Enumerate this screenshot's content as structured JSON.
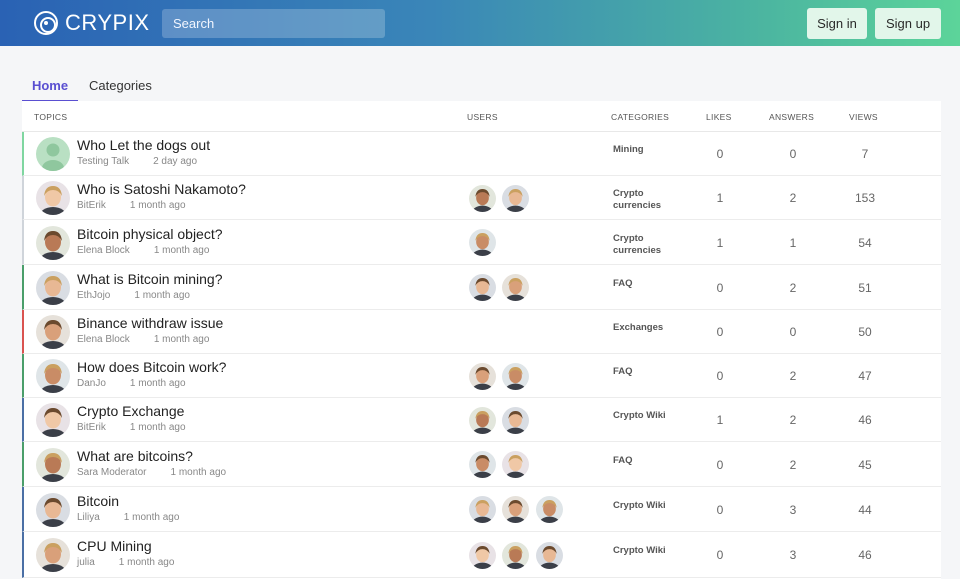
{
  "header": {
    "logo_text": "CRYPIX",
    "search_placeholder": "Search",
    "signin_label": "Sign in",
    "signup_label": "Sign up",
    "colors": {
      "gradient_start": "#2a62b4",
      "gradient_end": "#5cd49a",
      "button_bg": "#e2f6ea"
    }
  },
  "tabs": [
    {
      "label": "Home",
      "active": true
    },
    {
      "label": "Categories",
      "active": false
    }
  ],
  "accent_color": "#5a4fd1",
  "columns": {
    "topics": "TOPICS",
    "users": "USERS",
    "categories": "CATEGORIES",
    "likes": "LIKES",
    "answers": "ANSWERS",
    "views": "VIEWS"
  },
  "topics": [
    {
      "title": "Who Let the dogs out",
      "author": "Testing Talk",
      "time": "2 day ago",
      "category": "Mining",
      "likes": "0",
      "answers": "0",
      "views": "7",
      "border_color": "#7fd6a0",
      "avatar_icon": "default-avatar-icon",
      "users": []
    },
    {
      "title": "Who is Satoshi Nakamoto?",
      "author": "BitErik",
      "time": "1 month ago",
      "category": "Crypto currencies",
      "likes": "1",
      "answers": "2",
      "views": "153",
      "border_color": "#cfd4da",
      "avatar_icon": "user-avatar-icon",
      "users": [
        "user-avatar-icon",
        "user-avatar-icon"
      ]
    },
    {
      "title": "Bitcoin physical object?",
      "author": "Elena Block",
      "time": "1 month ago",
      "category": "Crypto currencies",
      "likes": "1",
      "answers": "1",
      "views": "54",
      "border_color": "#cfd4da",
      "avatar_icon": "user-avatar-icon",
      "users": [
        "user-avatar-icon"
      ]
    },
    {
      "title": "What is Bitcoin mining?",
      "author": "EthJojo",
      "time": "1 month ago",
      "category": "FAQ",
      "likes": "0",
      "answers": "2",
      "views": "51",
      "border_color": "#4a9e6a",
      "avatar_icon": "user-avatar-icon",
      "users": [
        "user-avatar-icon",
        "user-avatar-icon"
      ]
    },
    {
      "title": "Binance withdraw issue",
      "author": "Elena Block",
      "time": "1 month ago",
      "category": "Exchanges",
      "likes": "0",
      "answers": "0",
      "views": "50",
      "border_color": "#d9534f",
      "avatar_icon": "user-avatar-icon",
      "users": []
    },
    {
      "title": "How does Bitcoin work?",
      "author": "DanJo",
      "time": "1 month ago",
      "category": "FAQ",
      "likes": "0",
      "answers": "2",
      "views": "47",
      "border_color": "#4a9e6a",
      "avatar_icon": "user-avatar-icon",
      "users": [
        "user-avatar-icon",
        "user-avatar-icon"
      ]
    },
    {
      "title": "Crypto Exchange",
      "author": "BitErik",
      "time": "1 month ago",
      "category": "Crypto Wiki",
      "likes": "1",
      "answers": "2",
      "views": "46",
      "border_color": "#4a6fa5",
      "avatar_icon": "user-avatar-icon",
      "users": [
        "user-avatar-icon",
        "user-avatar-icon"
      ]
    },
    {
      "title": "What are bitcoins?",
      "author": "Sara Moderator",
      "time": "1 month ago",
      "category": "FAQ",
      "likes": "0",
      "answers": "2",
      "views": "45",
      "border_color": "#4a9e6a",
      "avatar_icon": "user-avatar-icon",
      "users": [
        "user-avatar-icon",
        "user-avatar-icon"
      ]
    },
    {
      "title": "Bitcoin",
      "author": "Liliya",
      "time": "1 month ago",
      "category": "Crypto Wiki",
      "likes": "0",
      "answers": "3",
      "views": "44",
      "border_color": "#4a6fa5",
      "avatar_icon": "user-avatar-icon",
      "users": [
        "user-avatar-icon",
        "user-avatar-icon",
        "user-avatar-icon"
      ]
    },
    {
      "title": "CPU Mining",
      "author": "julia",
      "time": "1 month ago",
      "category": "Crypto Wiki",
      "likes": "0",
      "answers": "3",
      "views": "46",
      "border_color": "#4a6fa5",
      "avatar_icon": "user-avatar-icon",
      "users": [
        "user-avatar-icon",
        "user-avatar-icon",
        "user-avatar-icon"
      ]
    }
  ]
}
